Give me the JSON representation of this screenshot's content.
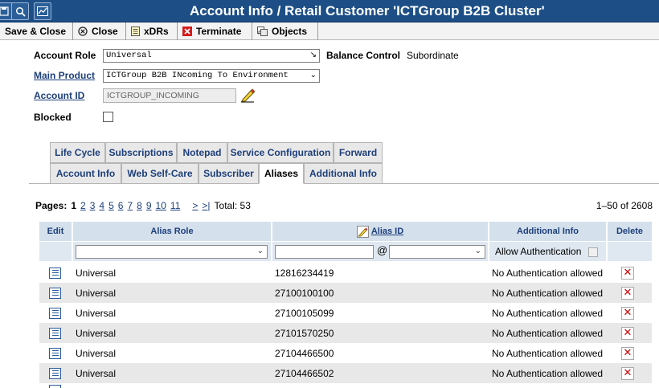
{
  "title": "Account Info / Retail Customer 'ICTGroup B2B Cluster'",
  "header_icons": [
    "disk-icon",
    "search-icon",
    "chart-icon"
  ],
  "toolbar": {
    "save_close": "Save & Close",
    "close": "Close",
    "xdrs": "xDRs",
    "terminate": "Terminate",
    "objects": "Objects"
  },
  "form": {
    "account_role_label": "Account Role",
    "account_role_value": "Universal",
    "balance_control_label": "Balance Control",
    "balance_control_value": "Subordinate",
    "main_product_label": "Main Product",
    "main_product_value": "ICTGroup B2B INcoming To Environment",
    "account_id_label": "Account ID",
    "account_id_value": "ICTGROUP_INCOMING",
    "blocked_label": "Blocked"
  },
  "tabs_row1": [
    "Life Cycle",
    "Subscriptions",
    "Notepad",
    "Service Configuration",
    "Forward"
  ],
  "tabs_row2": [
    "Account Info",
    "Web Self-Care",
    "Subscriber",
    "Aliases",
    "Additional Info"
  ],
  "active_tab": "Aliases",
  "pagination": {
    "label": "Pages:",
    "current": "1",
    "pages": [
      "2",
      "3",
      "4",
      "5",
      "6",
      "7",
      "8",
      "9",
      "10",
      "11"
    ],
    "next": ">",
    "last": ">|",
    "total": "Total: 53",
    "range": "1–50 of 2608"
  },
  "table": {
    "headers": {
      "edit": "Edit",
      "alias_role": "Alias Role",
      "alias_id": "Alias ID",
      "additional_info": "Additional Info",
      "delete": "Delete"
    },
    "filter": {
      "at_sign": "@",
      "allow_auth": "Allow Authentication"
    },
    "rows": [
      {
        "role": "Universal",
        "id": "12816234419",
        "info": "No Authentication allowed"
      },
      {
        "role": "Universal",
        "id": "27100100100",
        "info": "No Authentication allowed"
      },
      {
        "role": "Universal",
        "id": "27100105099",
        "info": "No Authentication allowed"
      },
      {
        "role": "Universal",
        "id": "27101570250",
        "info": "No Authentication allowed"
      },
      {
        "role": "Universal",
        "id": "27104466500",
        "info": "No Authentication allowed"
      },
      {
        "role": "Universal",
        "id": "27104466502",
        "info": "No Authentication allowed"
      }
    ]
  },
  "colors": {
    "titlebar": "#1d4f86",
    "link": "#1d3f7a",
    "header_cell": "#d4e0ec",
    "delete_x": "#d10000"
  }
}
